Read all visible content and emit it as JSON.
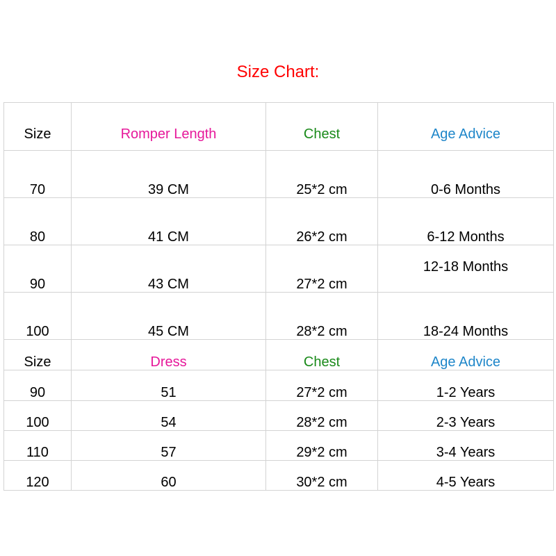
{
  "title": "Size Chart:",
  "colors": {
    "title": "#ff0000",
    "romper_length": "#e6189a",
    "dress": "#e6189a",
    "chest": "#1a8a1a",
    "age_advice": "#1e86c9",
    "grid": "#d3d3d3"
  },
  "romper": {
    "headers": [
      "Size",
      "Romper Length",
      "Chest",
      "Age Advice"
    ],
    "rows": [
      [
        "70",
        "39  CM",
        "25*2 cm",
        "0-6 Months"
      ],
      [
        "80",
        "41 CM",
        "26*2 cm",
        "6-12 Months"
      ],
      [
        "90",
        "43 CM",
        "27*2 cm",
        "12-18 Months"
      ],
      [
        "100",
        "45 CM",
        "28*2 cm",
        "18-24 Months"
      ]
    ]
  },
  "dress": {
    "headers": [
      "Size",
      "Dress",
      "Chest",
      "Age Advice"
    ],
    "rows": [
      [
        "90",
        "51",
        "27*2 cm",
        "1-2 Years"
      ],
      [
        "100",
        "54",
        "28*2 cm",
        "2-3 Years"
      ],
      [
        "110",
        "57",
        "29*2 cm",
        "3-4 Years"
      ],
      [
        "120",
        "60",
        "30*2 cm",
        "4-5 Years"
      ]
    ]
  }
}
